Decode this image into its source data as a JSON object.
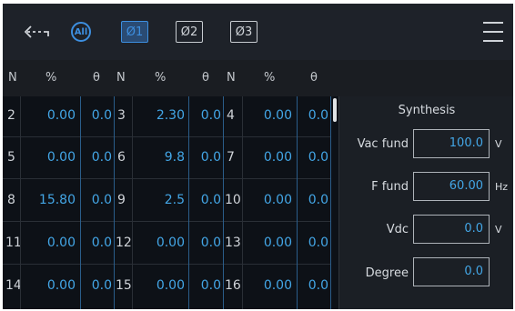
{
  "toolbar": {
    "phases": [
      {
        "label": "Ø1",
        "active": true
      },
      {
        "label": "Ø2",
        "active": false
      },
      {
        "label": "Ø3",
        "active": false
      }
    ],
    "all_label": "All",
    "icons": {
      "back": "back-arrow-icon",
      "menu": "hamburger-menu-icon"
    },
    "accent_color": "#3d8fe0"
  },
  "table": {
    "headers": [
      "N",
      "%",
      "θ",
      "N",
      "%",
      "θ",
      "N",
      "%",
      "θ"
    ],
    "rows": [
      [
        {
          "n": "2",
          "pct": "0.00",
          "theta": "0.0"
        },
        {
          "n": "3",
          "pct": "2.30",
          "theta": "0.0"
        },
        {
          "n": "4",
          "pct": "0.00",
          "theta": "0.0"
        }
      ],
      [
        {
          "n": "5",
          "pct": "0.00",
          "theta": "0.0"
        },
        {
          "n": "6",
          "pct": "9.8",
          "theta": "0.0"
        },
        {
          "n": "7",
          "pct": "0.00",
          "theta": "0.0"
        }
      ],
      [
        {
          "n": "8",
          "pct": "15.80",
          "theta": "0.0"
        },
        {
          "n": "9",
          "pct": "2.5",
          "theta": "0.0"
        },
        {
          "n": "10",
          "pct": "0.00",
          "theta": "0.0"
        }
      ],
      [
        {
          "n": "11",
          "pct": "0.00",
          "theta": "0.0"
        },
        {
          "n": "12",
          "pct": "0.00",
          "theta": "0.0"
        },
        {
          "n": "13",
          "pct": "0.00",
          "theta": "0.0"
        }
      ],
      [
        {
          "n": "14",
          "pct": "0.00",
          "theta": "0.0"
        },
        {
          "n": "15",
          "pct": "0.00",
          "theta": "0.0"
        },
        {
          "n": "16",
          "pct": "0.00",
          "theta": "0.0"
        }
      ]
    ],
    "value_color": "#43a6e6"
  },
  "synthesis": {
    "title": "Synthesis",
    "vac_fund": {
      "label": "Vac fund",
      "value": "100.0",
      "unit": "V"
    },
    "f_fund": {
      "label": "F fund",
      "value": "60.00",
      "unit": "Hz"
    },
    "vdc": {
      "label": "Vdc",
      "value": "0.0",
      "unit": "V"
    },
    "degree": {
      "label": "Degree",
      "value": "0.0"
    }
  }
}
